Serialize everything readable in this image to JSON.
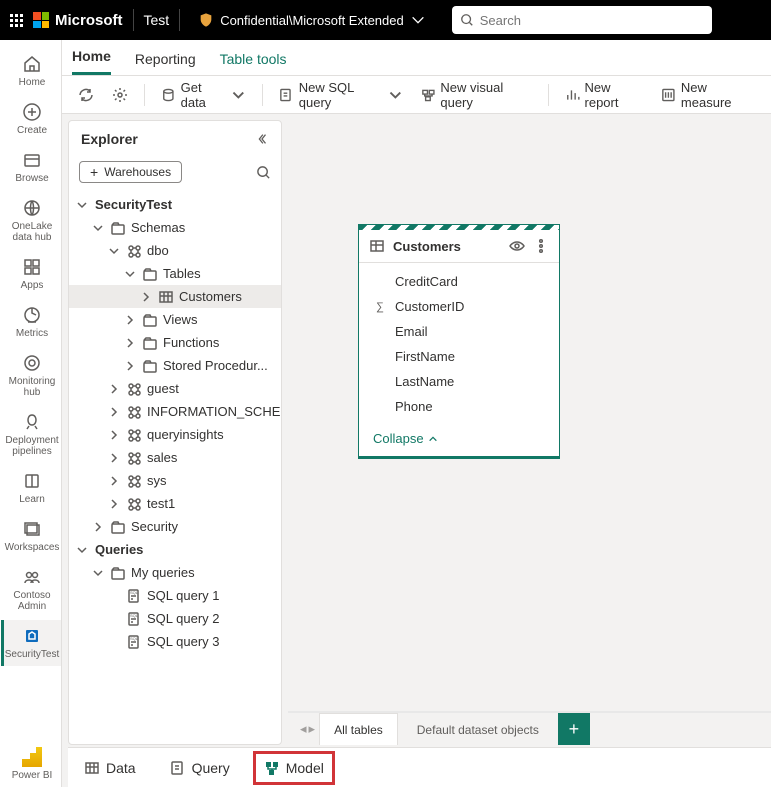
{
  "topbar": {
    "brand": "Microsoft",
    "app": "Test",
    "classification": "Confidential\\Microsoft Extended",
    "search_placeholder": "Search"
  },
  "leftrail": [
    {
      "id": "home",
      "label": "Home"
    },
    {
      "id": "create",
      "label": "Create"
    },
    {
      "id": "browse",
      "label": "Browse"
    },
    {
      "id": "onelake",
      "label": "OneLake data hub"
    },
    {
      "id": "apps",
      "label": "Apps"
    },
    {
      "id": "metrics",
      "label": "Metrics"
    },
    {
      "id": "monitor",
      "label": "Monitoring hub"
    },
    {
      "id": "deploy",
      "label": "Deployment pipelines"
    },
    {
      "id": "learn",
      "label": "Learn"
    },
    {
      "id": "ws",
      "label": "Workspaces"
    },
    {
      "id": "admin",
      "label": "Contoso Admin"
    },
    {
      "id": "sectest",
      "label": "SecurityTest"
    }
  ],
  "leftrail_bottom": {
    "label": "Power BI"
  },
  "tabs": [
    {
      "label": "Home",
      "active": true
    },
    {
      "label": "Reporting"
    },
    {
      "label": "Table tools",
      "green": true
    }
  ],
  "ribbon": {
    "get_data": "Get data",
    "new_sql": "New SQL query",
    "new_visual": "New visual query",
    "new_report": "New report",
    "new_measure": "New measure"
  },
  "explorer": {
    "title": "Explorer",
    "warehouses_btn": "Warehouses",
    "tree": [
      {
        "lvl": 0,
        "chev": "d",
        "bold": true,
        "label": "SecurityTest"
      },
      {
        "lvl": 1,
        "chev": "d",
        "icon": "folder",
        "label": "Schemas"
      },
      {
        "lvl": 2,
        "chev": "d",
        "icon": "schema",
        "label": "dbo"
      },
      {
        "lvl": 3,
        "chev": "d",
        "icon": "folder",
        "label": "Tables"
      },
      {
        "lvl": 4,
        "chev": "r",
        "icon": "table",
        "label": "Customers",
        "sel": true
      },
      {
        "lvl": 3,
        "chev": "r",
        "icon": "folder",
        "label": "Views"
      },
      {
        "lvl": 3,
        "chev": "r",
        "icon": "folder",
        "label": "Functions"
      },
      {
        "lvl": 3,
        "chev": "r",
        "icon": "folder",
        "label": "Stored Procedur..."
      },
      {
        "lvl": 2,
        "chev": "r",
        "icon": "schema",
        "label": "guest"
      },
      {
        "lvl": 2,
        "chev": "r",
        "icon": "schema",
        "label": "INFORMATION_SCHE..."
      },
      {
        "lvl": 2,
        "chev": "r",
        "icon": "schema",
        "label": "queryinsights"
      },
      {
        "lvl": 2,
        "chev": "r",
        "icon": "schema",
        "label": "sales"
      },
      {
        "lvl": 2,
        "chev": "r",
        "icon": "schema",
        "label": "sys"
      },
      {
        "lvl": 2,
        "chev": "r",
        "icon": "schema",
        "label": "test1"
      },
      {
        "lvl": 1,
        "chev": "r",
        "icon": "folder",
        "label": "Security"
      },
      {
        "lvl": 0,
        "chev": "d",
        "bold": true,
        "label": "Queries"
      },
      {
        "lvl": 1,
        "chev": "d",
        "icon": "folder",
        "label": "My queries"
      },
      {
        "lvl": 2,
        "icon": "sql",
        "label": "SQL query 1"
      },
      {
        "lvl": 2,
        "icon": "sql",
        "label": "SQL query 2"
      },
      {
        "lvl": 2,
        "icon": "sql",
        "label": "SQL query 3"
      }
    ]
  },
  "card": {
    "title": "Customers",
    "fields": [
      {
        "name": "CreditCard",
        "agg": false
      },
      {
        "name": "CustomerID",
        "agg": true
      },
      {
        "name": "Email",
        "agg": false
      },
      {
        "name": "FirstName",
        "agg": false
      },
      {
        "name": "LastName",
        "agg": false
      },
      {
        "name": "Phone",
        "agg": false
      }
    ],
    "collapse": "Collapse"
  },
  "bottom_tabs": [
    {
      "label": "All tables",
      "active": true
    },
    {
      "label": "Default dataset objects"
    }
  ],
  "view_modes": [
    {
      "id": "data",
      "label": "Data"
    },
    {
      "id": "query",
      "label": "Query"
    },
    {
      "id": "model",
      "label": "Model",
      "active": true
    }
  ]
}
